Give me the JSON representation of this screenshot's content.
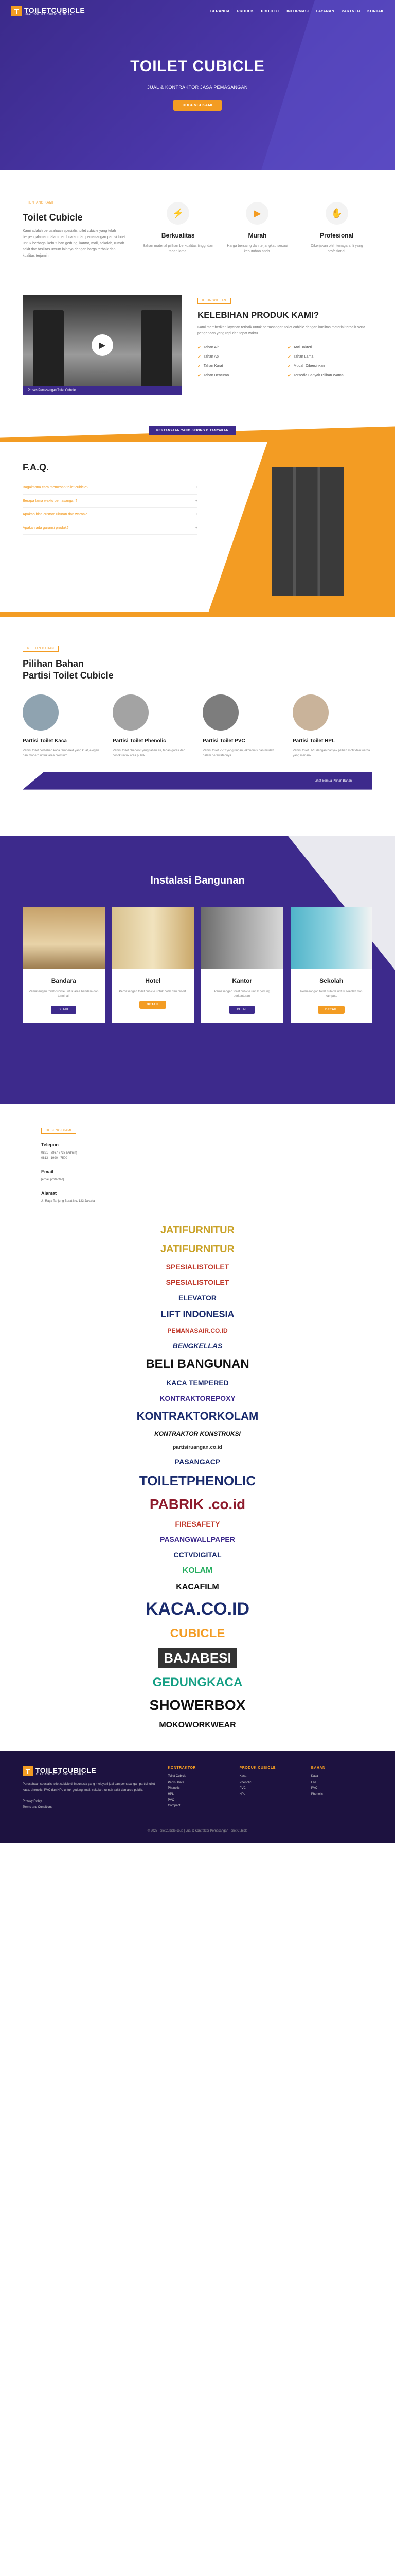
{
  "brand": {
    "name": "TOILETCUBICLE",
    "tagline": "JUAL TOILET CUBICLE MURAH"
  },
  "nav": [
    "BERANDA",
    "PRODUK",
    "PROJECT",
    "INFORMASI",
    "LAYANAN",
    "PARTNER",
    "KONTAK"
  ],
  "hero": {
    "title": "TOILET CUBICLE",
    "subtitle": "JUAL & KONTRAKTOR JASA PEMASANGAN",
    "button": "HUBUNGI KAMI"
  },
  "intro": {
    "tag": "TENTANG KAMI",
    "title": "Toilet Cubicle",
    "text": "Kami adalah perusahaan spesialis toilet cubicle yang telah berpengalaman dalam pembuatan dan pemasangan partisi toilet untuk berbagai kebutuhan gedung, kantor, mall, sekolah, rumah sakit dan fasilitas umum lainnya dengan harga terbaik dan kualitas terjamin.",
    "features": [
      {
        "icon": "bolt-icon",
        "title": "Berkualitas",
        "text": "Bahan material pilihan berkualitas tinggi dan tahan lama."
      },
      {
        "icon": "video-icon",
        "title": "Murah",
        "text": "Harga bersaing dan terjangkau sesuai kebutuhan anda."
      },
      {
        "icon": "handshake-icon",
        "title": "Profesional",
        "text": "Dikerjakan oleh tenaga ahli yang profesional."
      }
    ]
  },
  "video": {
    "caption": "Proses Pemasangan Toilet Cubicle"
  },
  "advantages": {
    "tag": "KEUNGGULAN",
    "title": "KELEBIHAN PRODUK KAMI?",
    "text": "Kami memberikan layanan terbaik untuk pemasangan toilet cubicle dengan kualitas material terbaik serta pengerjaan yang rapi dan tepat waktu.",
    "items": [
      "Tahan Air",
      "Anti Bakteri",
      "Tahan Api",
      "Tahan Lama",
      "Tahan Karat",
      "Mudah Dibersihkan",
      "Tahan Benturan",
      "Tersedia Banyak Pilihan Warna"
    ]
  },
  "faq": {
    "banner": "PERTANYAAN YANG SERING DITANYAKAN",
    "title": "F.A.Q.",
    "items": [
      "Bagaimana cara memesan toilet cubicle?",
      "Berapa lama waktu pemasangan?",
      "Apakah bisa custom ukuran dan warna?",
      "Apakah ada garansi produk?"
    ]
  },
  "materials": {
    "tag": "PILIHAN BAHAN",
    "title_line1": "Pilihan Bahan",
    "title_line2": "Partisi Toilet Cubicle",
    "cards": [
      {
        "title": "Partisi Toilet Kaca",
        "text": "Partisi toilet berbahan kaca tempered yang kuat, elegan dan modern untuk area premium.",
        "color": "#8fa3b0"
      },
      {
        "title": "Partisi Toilet Phenolic",
        "text": "Partisi toilet phenolic yang tahan air, tahan gores dan cocok untuk area publik.",
        "color": "#a3a3a3"
      },
      {
        "title": "Partisi Toilet PVC",
        "text": "Partisi toilet PVC yang ringan, ekonomis dan mudah dalam perawatannya.",
        "color": "#7d7d7d"
      },
      {
        "title": "Partisi Toilet HPL",
        "text": "Partisi toilet HPL dengan banyak pilihan motif dan warna yang menarik.",
        "color": "#c9b39a"
      }
    ],
    "bar_text": "Lihat Semua Pilihan Bahan"
  },
  "installation": {
    "title": "Instalasi Bangunan",
    "cards": [
      {
        "title": "Bandara",
        "text": "Pemasangan toilet cubicle untuk area bandara dan terminal.",
        "button": "DETAIL",
        "style": "purple"
      },
      {
        "title": "Hotel",
        "text": "Pemasangan toilet cubicle untuk hotel dan resort.",
        "button": "DETAIL",
        "style": "orange"
      },
      {
        "title": "Kantor",
        "text": "Pemasangan toilet cubicle untuk gedung perkantoran.",
        "button": "DETAIL",
        "style": "purple"
      },
      {
        "title": "Sekolah",
        "text": "Pemasangan toilet cubicle untuk sekolah dan kampus.",
        "button": "DETAIL",
        "style": "orange"
      }
    ]
  },
  "contact": {
    "tag": "HUBUNGI KAMI",
    "phone_label": "Telepon",
    "phones": [
      "0821 - 8867 7733 (Admin)",
      "0813 - 1990 - 7500"
    ],
    "email_label": "Email",
    "email": "[email protected]",
    "address_label": "Alamat",
    "address": "Jl. Raya Tanjung Barat No. 123 Jakarta"
  },
  "partners": [
    "JATIFURNITUR",
    "JATIFURNITUR",
    "SPESIALISTOILET",
    "SPESIALISTOILET",
    "ELEVATOR",
    "LIFT INDONESIA",
    "PEMANASAIR.CO.ID",
    "BENGKELLAS",
    "BELI BANGUNAN",
    "KACA TEMPERED",
    "KONTRAKTOREPOXY",
    "KONTRAKTORKOLAM",
    "KONTRAKTOR KONSTRUKSI",
    "partisiruangan.co.id",
    "PASANGACP",
    "TOILETPHENOLIC",
    "PABRIK .co.id",
    "FIRESAFETY",
    "PASANGWALLPAPER",
    "CCTVDIGITAL",
    "KOLAM",
    "KACAFILM",
    "KACA.CO.ID",
    "CUBICLE",
    "BAJABESI",
    "GEDUNGKACA",
    "SHOWERBOX",
    "MOKOWORKWEAR"
  ],
  "footer": {
    "about": "Perusahaan spesialis toilet cubicle di Indonesia yang melayani jual dan pemasangan partisi toilet kaca, phenolic, PVC dan HPL untuk gedung, mall, sekolah, rumah sakit dan area publik.",
    "col2_title": "KONTRAKTOR",
    "col2": [
      "Toilet Cubicle",
      "Partisi Kaca",
      "Phenolic",
      "HPL",
      "PVC",
      "Compact"
    ],
    "col3_title": "PRODUK CUBICLE",
    "col3": [
      "Kaca",
      "Phenolic",
      "PVC",
      "HPL"
    ],
    "col4_title": "BAHAN",
    "col4": [
      "Kaca",
      "HPL",
      "PVC",
      "Phenolic"
    ],
    "links": [
      "Privacy Policy",
      "Terms and Conditions"
    ],
    "copyright": "© 2023 ToiletCubicle.co.id | Jual & Kontraktor Pemasangan Toilet Cubicle"
  }
}
